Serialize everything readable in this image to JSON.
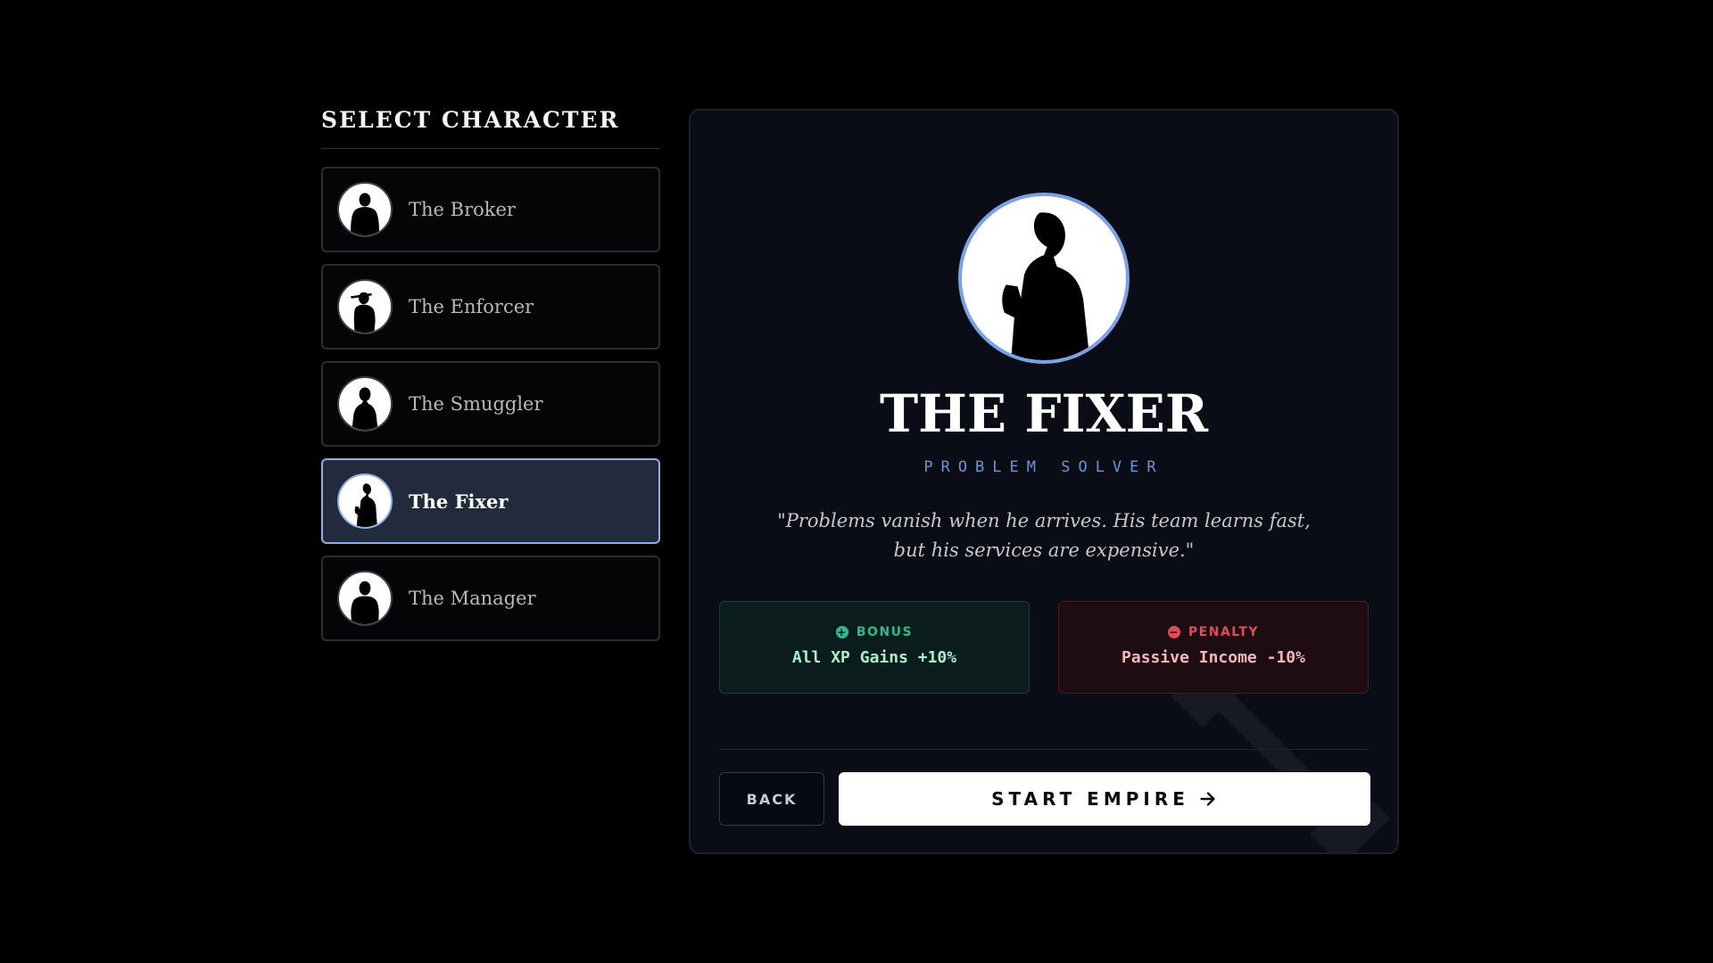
{
  "sidebar": {
    "title": "SELECT CHARACTER",
    "items": [
      {
        "label": "The Broker",
        "icon": "broker-silhouette-icon"
      },
      {
        "label": "The Enforcer",
        "icon": "enforcer-silhouette-icon"
      },
      {
        "label": "The Smuggler",
        "icon": "smuggler-silhouette-icon"
      },
      {
        "label": "The Fixer",
        "icon": "fixer-silhouette-icon",
        "selected": true
      },
      {
        "label": "The Manager",
        "icon": "manager-silhouette-icon"
      }
    ]
  },
  "detail": {
    "name": "THE FIXER",
    "subtitle": "PROBLEM SOLVER",
    "quote": "\"Problems vanish when he arrives. His team learns fast, but his services are expensive.\"",
    "bonus": {
      "label": "BONUS",
      "value": "All XP Gains +10%",
      "color": "#2fb98a"
    },
    "penalty": {
      "label": "PENALTY",
      "value": "Passive Income -10%",
      "color": "#e24b55"
    }
  },
  "actions": {
    "back_label": "BACK",
    "start_label": "START EMPIRE"
  },
  "colors": {
    "accent": "#7aa2e6",
    "selected_bg": "#222b3c",
    "panel_bg": "#0a0d16"
  }
}
